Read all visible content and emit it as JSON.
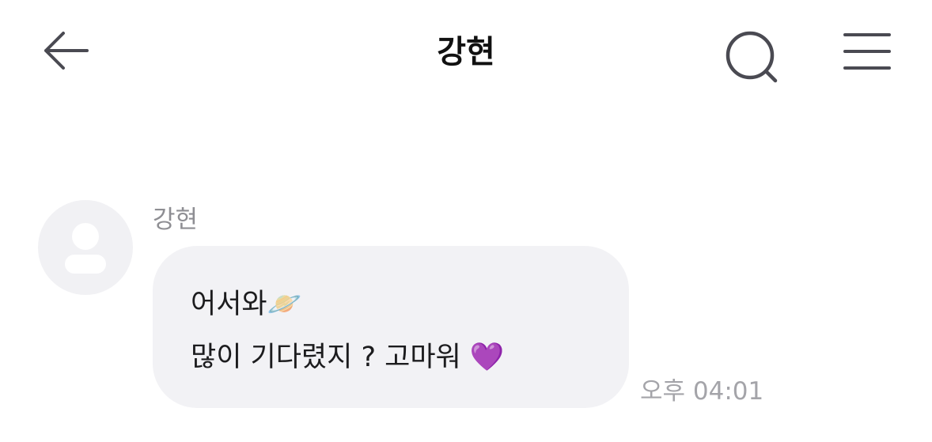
{
  "header": {
    "title": "강현",
    "back_icon": "arrow-left-icon",
    "search_icon": "search-icon",
    "menu_icon": "hamburger-menu-icon"
  },
  "messages": [
    {
      "sender": "강현",
      "avatar_icon": "default-person-avatar-icon",
      "lines": [
        "어서와🪐",
        "많이 기다렸지 ? 고마워 💜"
      ],
      "time": "오후 04:01"
    }
  ],
  "colors": {
    "bubble": "#f2f2f5",
    "avatar_bg": "#f1f1f4",
    "icon_stroke": "#4a4a52",
    "muted_text": "#8e8e93"
  }
}
